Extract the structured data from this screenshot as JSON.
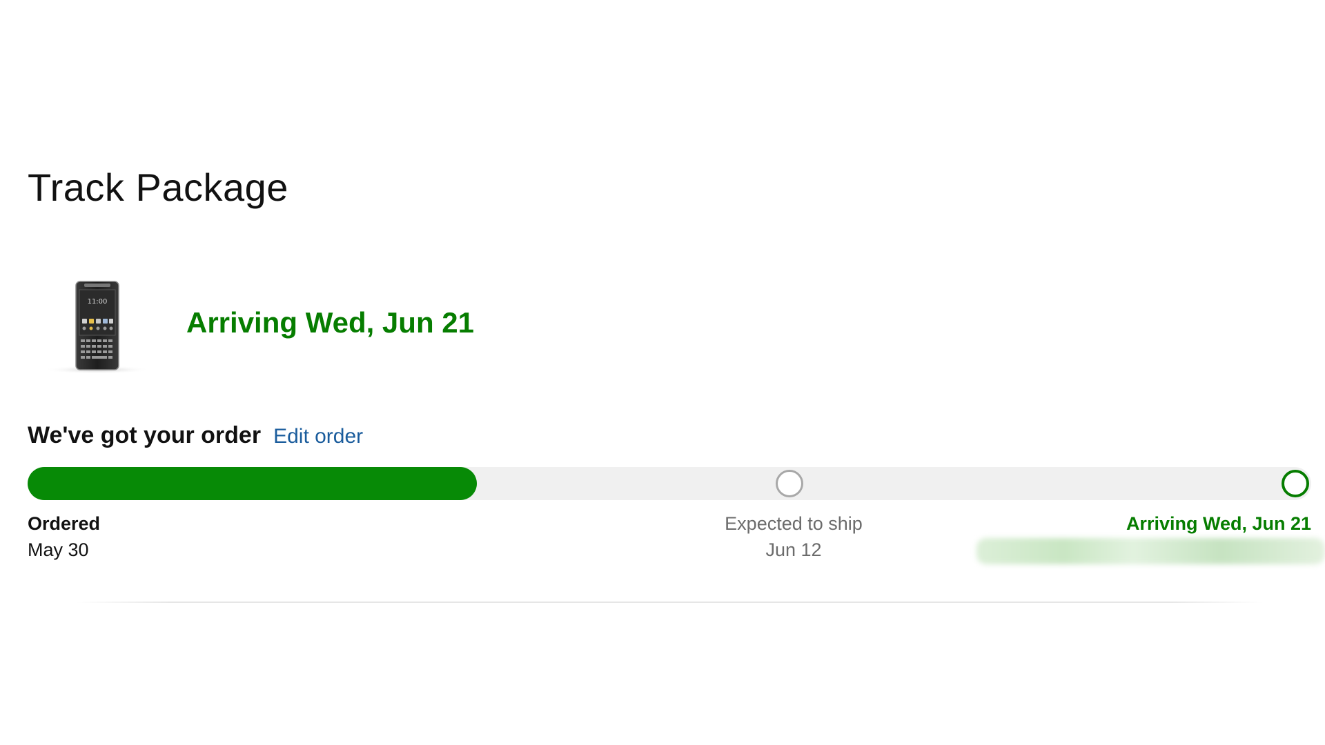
{
  "page": {
    "title": "Track Package"
  },
  "product": {
    "image_icon": "smartphone-product-image",
    "phone_screen_time": "11:00"
  },
  "delivery": {
    "headline": "Arriving Wed, Jun 21"
  },
  "status": {
    "title": "We've got your order",
    "edit_link": "Edit order"
  },
  "progress": {
    "fill_fraction": 0.35,
    "milestones": [
      {
        "label": "Ordered",
        "date": "May 30",
        "state": "complete"
      },
      {
        "label": "Expected to ship",
        "date": "Jun 12",
        "state": "pending"
      },
      {
        "label": "Arriving Wed, Jun 21",
        "date": "",
        "state": "target"
      }
    ]
  },
  "colors": {
    "accent_green": "#067d00",
    "progress_green": "#078a06",
    "link_blue": "#1a5c9c",
    "track_gray": "#f0f0f0",
    "pending_gray": "#a8a8a8"
  }
}
